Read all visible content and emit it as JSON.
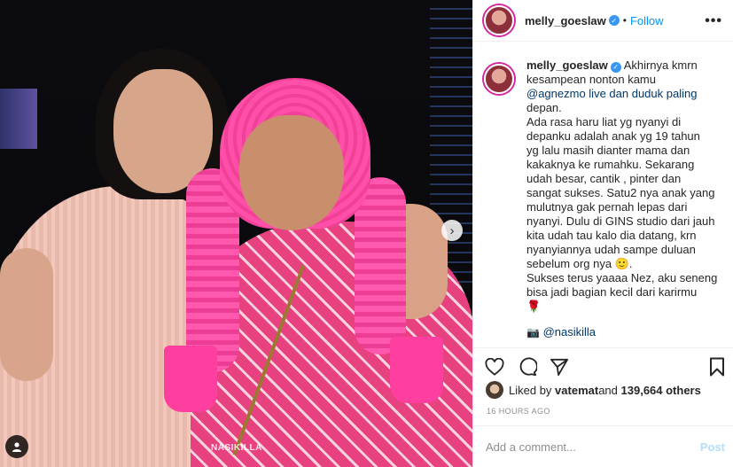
{
  "post": {
    "photo_watermark": "NASIKILLA",
    "username": "melly_goeslaw",
    "follow_label": "Follow",
    "dot": "•",
    "more": "•••",
    "caption_lines": [
      "Akhirnya kmrn",
      "kesampean nonton kamu",
      "@agnezmo live dan duduk paling",
      "depan.",
      "Ada rasa haru liat yg nyanyi di",
      "depanku adalah anak yg 19 tahun",
      "yg lalu masih dianter mama dan",
      "kakaknya ke rumahku. Sekarang",
      "udah besar, cantik , pinter dan",
      "sangat sukses. Satu2 nya anak yang",
      "mulutnya gak pernah lepas dari",
      "nyanyi. Dulu di GINS studio dari jauh",
      "kita udah tau kalo dia datang, krn",
      "nyanyiannya udah sampe duluan",
      "sebelum org nya 🙂.",
      "Sukses terus yaaaa Nez, aku seneng",
      "bisa jadi bagian kecil dari karirmu",
      "🌹"
    ],
    "credit_icon": "📷",
    "credit_mention": "@nasikilla",
    "liked_by_prefix": "Liked by ",
    "liked_by_user": "vatemat",
    "liked_by_and": " and ",
    "liked_count": "139,664 others",
    "timestamp": "16 HOURS AGO",
    "comment_placeholder": "Add a comment...",
    "post_label": "Post",
    "accent_color": "#0095f6"
  }
}
